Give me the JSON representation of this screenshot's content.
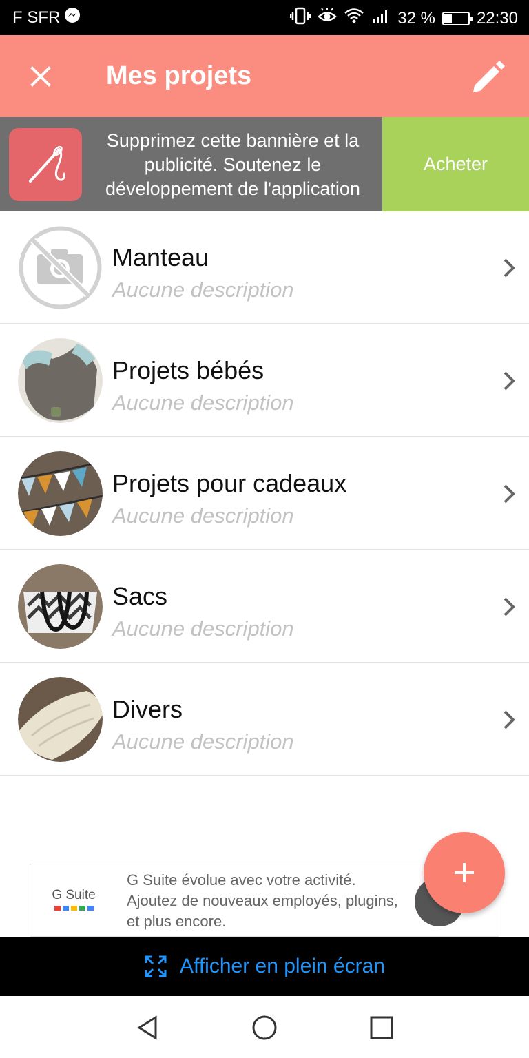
{
  "status_bar": {
    "carrier": "F SFR",
    "battery_percent": "32 %",
    "battery_level": 0.32,
    "time": "22:30",
    "icons": [
      "messenger-icon",
      "vibrate-icon",
      "eye-icon",
      "wifi-icon",
      "signal-icon",
      "battery-icon"
    ]
  },
  "app_bar": {
    "title": "Mes projets",
    "close_icon": "close-icon",
    "edit_icon": "pencil-icon",
    "background": "#fa8c80"
  },
  "promo": {
    "text": "Supprimez cette bannière et la publicité. Soutenez le développement de l'application",
    "button_label": "Acheter",
    "logo_icon": "needle-thread-icon",
    "button_color": "#a8d25a"
  },
  "projects": [
    {
      "name": "Manteau",
      "description": "Aucune description",
      "thumbnail": "no-photo-icon"
    },
    {
      "name": "Projets bébés",
      "description": "Aucune description",
      "thumbnail": "photo"
    },
    {
      "name": "Projets pour cadeaux",
      "description": "Aucune description",
      "thumbnail": "photo"
    },
    {
      "name": "Sacs",
      "description": "Aucune description",
      "thumbnail": "photo"
    },
    {
      "name": "Divers",
      "description": "Aucune description",
      "thumbnail": "photo"
    }
  ],
  "ad": {
    "brand": "G Suite",
    "text": "G Suite évolue avec votre activité. Ajoutez de nouveaux employés, plugins, et plus encore."
  },
  "fab": {
    "icon": "plus-icon",
    "color": "#fa8172"
  },
  "fullscreen": {
    "label": "Afficher en plein écran",
    "icon": "expand-icon",
    "color": "#1e96ff"
  },
  "nav": {
    "icons": [
      "back-icon",
      "home-icon",
      "recents-icon"
    ]
  }
}
